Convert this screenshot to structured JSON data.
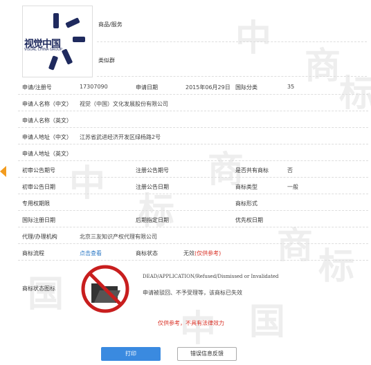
{
  "watermark_chars": [
    "中",
    "商",
    "标",
    "中",
    "国",
    "商",
    "标",
    "国",
    "商",
    "标",
    "中"
  ],
  "logo": {
    "text": "视觉中国",
    "subtext": "VISUAL CHINA GROUP"
  },
  "side": {
    "goods_services": "商品/服务",
    "similar_group": "类似群"
  },
  "rows": [
    {
      "label": "申请/注册号",
      "value": "17307090",
      "label2": "申请日期",
      "value2": "2015年06月29日",
      "label3": "国际分类",
      "value3": "35"
    },
    {
      "label": "申请人名称（中文）",
      "value": "视觉（中国）文化发展股份有限公司"
    },
    {
      "label": "申请人名称（英文）",
      "value": ""
    },
    {
      "label": "申请人地址（中文）",
      "value": "江苏省武进经济开发区绿杨路2号"
    },
    {
      "label": "申请人地址（英文）",
      "value": ""
    },
    {
      "label": "初审公告期号",
      "value": "",
      "label2": "注册公告期号",
      "value2": "",
      "label3": "是否共有商标",
      "value3": "否"
    },
    {
      "label": "初审公告日期",
      "value": "",
      "label2": "注册公告日期",
      "value2": "",
      "label3": "商标类型",
      "value3": "一般"
    },
    {
      "label": "专用权期限",
      "value": "",
      "label3": "商标形式",
      "value3": ""
    },
    {
      "label": "国际注册日期",
      "value": "",
      "label2": "后期指定日期",
      "value2": "",
      "label3": "优先权日期",
      "value3": ""
    },
    {
      "label": "代理/办理机构",
      "value": "北京三友知识产权代理有限公司"
    }
  ],
  "flow": {
    "label": "商标流程",
    "link": "点击查看",
    "status_label": "商标状态",
    "status_value": "无效",
    "status_note": "(仅供参考)"
  },
  "status_icon": {
    "label": "商标状态图标",
    "icon": "invalid-folder-icon",
    "en": "DEAD/APPLICATION/Refused/Dismissed or Invalidated",
    "cn": "申请被驳回、不予受理等，该商标已失效"
  },
  "disclaimer": "仅供参考，不具有法律效力",
  "buttons": {
    "print": "打印",
    "feedback": "错误信息反馈"
  },
  "colors": {
    "link": "#2b78c5",
    "red": "#d93025",
    "primary_button": "#3a8ae0",
    "arrow": "#f39c1e"
  }
}
